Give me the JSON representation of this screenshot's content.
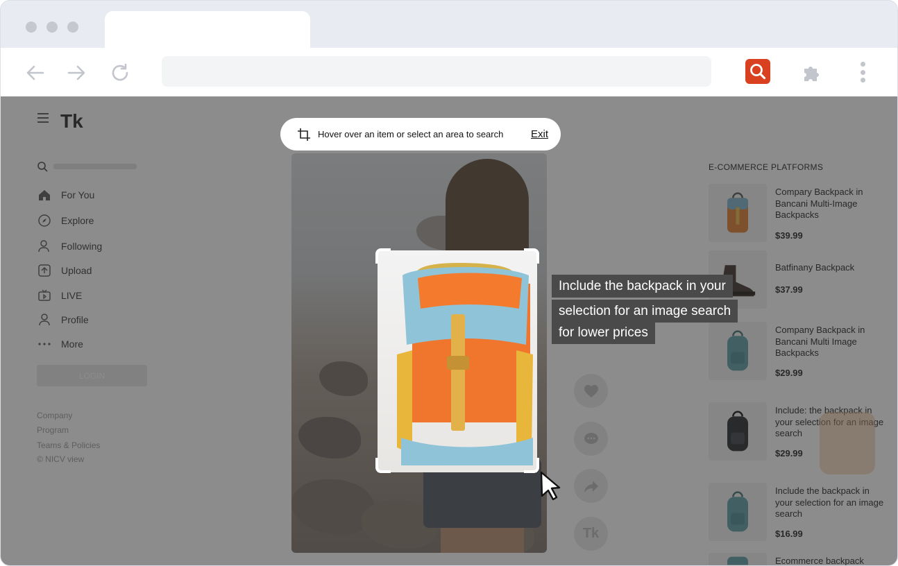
{
  "browser": {
    "colors": {
      "chrome_bg": "#e9ebf2",
      "extension_accent": "#d8401f"
    },
    "icons": [
      "back-arrow-icon",
      "forward-arrow-icon",
      "reload-icon",
      "search-extension-icon",
      "puzzle-icon",
      "kebab-menu-icon"
    ]
  },
  "sidebar": {
    "logo": "Tk",
    "nav": [
      {
        "label": "For You",
        "icon": "home-icon"
      },
      {
        "label": "Explore",
        "icon": "compass-icon"
      },
      {
        "label": "Following",
        "icon": "user-icon"
      },
      {
        "label": "Upload",
        "icon": "upload-icon"
      },
      {
        "label": "LIVE",
        "icon": "live-tv-icon"
      },
      {
        "label": "Profile",
        "icon": "profile-icon"
      },
      {
        "label": "More",
        "icon": "more-dots-icon"
      }
    ],
    "login_label": "LOGIN",
    "footer": [
      "Company",
      "Program",
      "Teams & Policies",
      "© NICV view"
    ]
  },
  "search_overlay": {
    "hint": "Hover over an item or select an area to search",
    "exit_label": "Exit",
    "tooltip_lines": [
      "Include the backpack in your",
      "selection for an image search",
      "for lower prices"
    ]
  },
  "video_actions": [
    {
      "icon": "heart-icon"
    },
    {
      "icon": "comment-icon"
    },
    {
      "icon": "share-icon"
    },
    {
      "icon": "tk-logo-icon",
      "label": "Tk"
    }
  ],
  "results": {
    "heading": "E-COMMERCE PLATFORMS",
    "items": [
      {
        "title": "Compary Backpack in Bancani Multi-Image Backpacks",
        "price": "$39.99",
        "thumb": "orange-backpack-icon"
      },
      {
        "title": "Batfinany Backpack",
        "price": "$37.99",
        "thumb": "boot-icon"
      },
      {
        "title": "Company Backpack in Bancani Multi Image Backpacks",
        "price": "$29.99",
        "thumb": "teal-backpack-icon"
      },
      {
        "title": "Include: the backpack in your selection for an image search",
        "price": "$29.99",
        "thumb": "black-backpack-icon"
      },
      {
        "title": "Include the backpack in your selection for an image search",
        "price": "$16.99",
        "thumb": "teal-backpack-icon"
      },
      {
        "title": "Ecommerce backpack",
        "price": "",
        "thumb": "teal-backpack-icon"
      }
    ]
  }
}
